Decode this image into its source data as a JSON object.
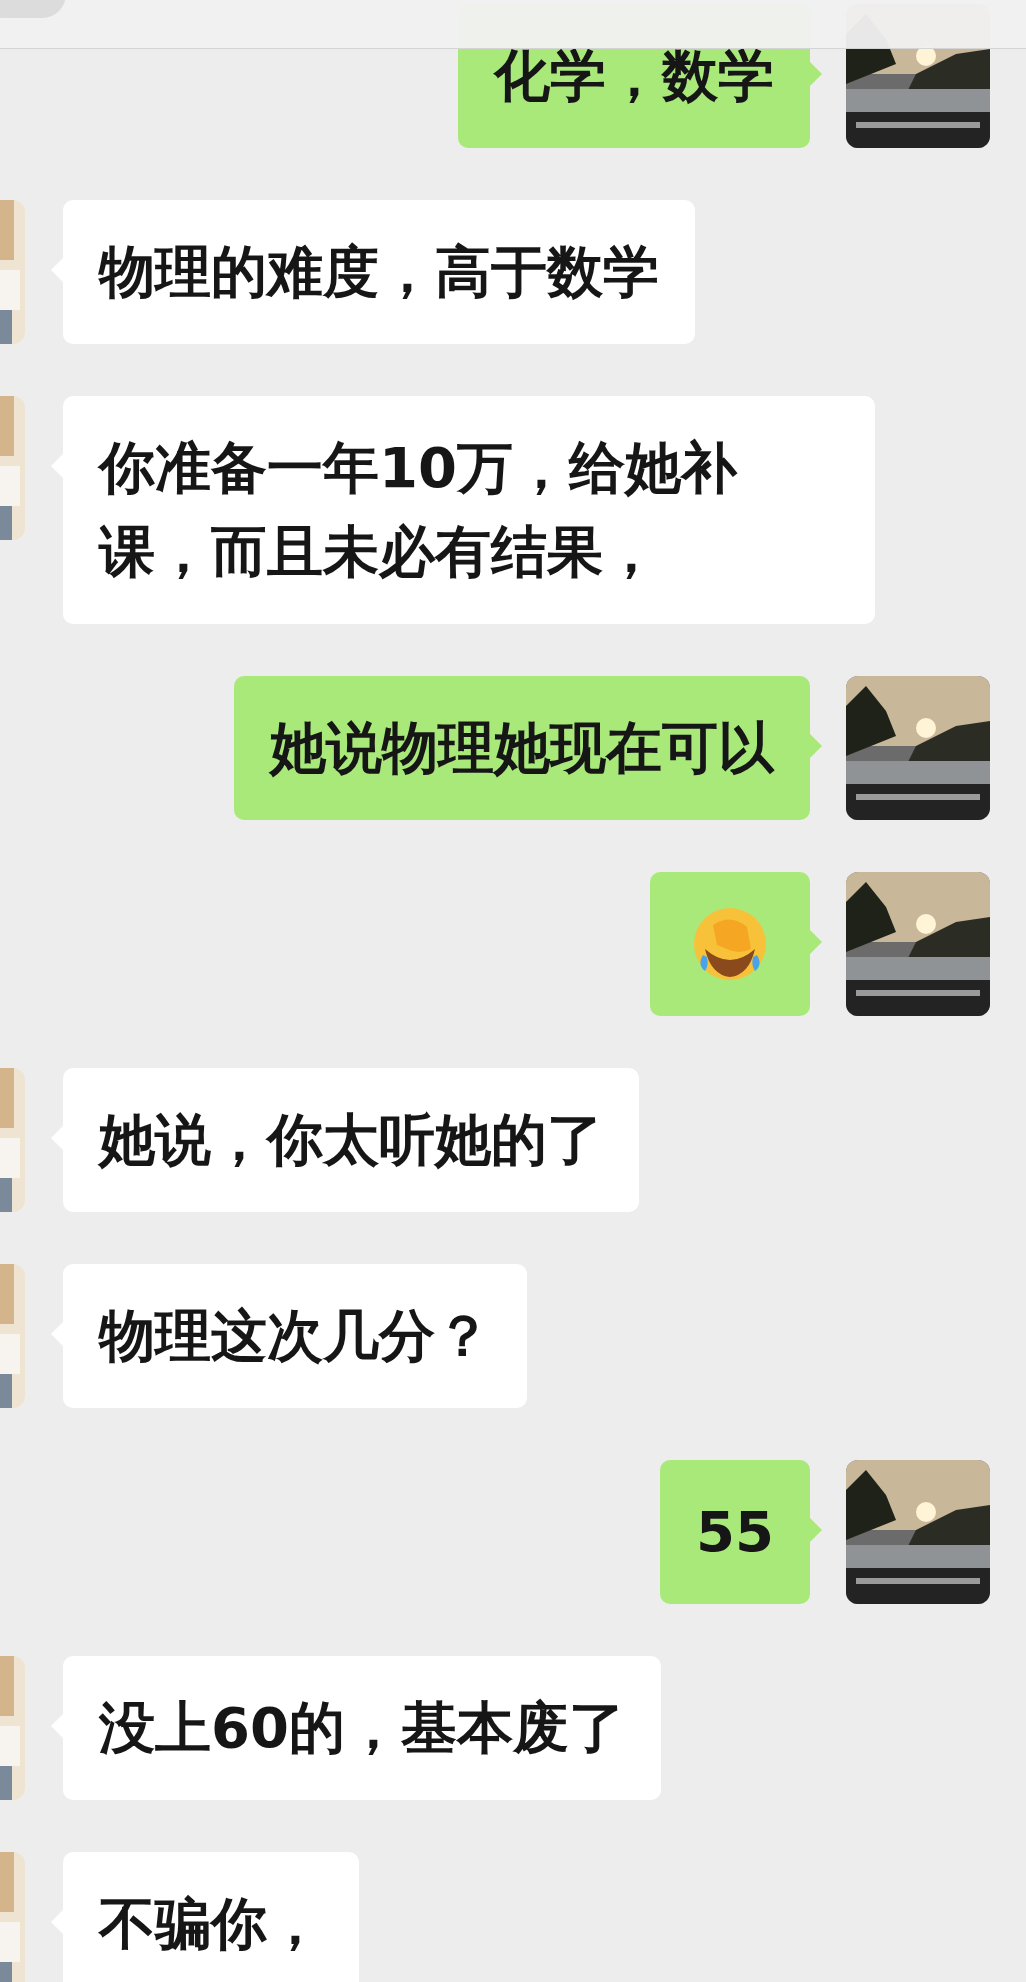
{
  "messages": [
    {
      "outgoing": true,
      "kind": "text",
      "text": "化学，数学"
    },
    {
      "outgoing": false,
      "kind": "text",
      "text": "物理的难度，高于数学"
    },
    {
      "outgoing": false,
      "kind": "text",
      "text": "你准备一年10万，给她补课，而且未必有结果，"
    },
    {
      "outgoing": true,
      "kind": "text",
      "text": "她说物理她现在可以"
    },
    {
      "outgoing": true,
      "kind": "emoji"
    },
    {
      "outgoing": false,
      "kind": "text",
      "text": "她说，你太听她的了"
    },
    {
      "outgoing": false,
      "kind": "text",
      "text": "物理这次几分？"
    },
    {
      "outgoing": true,
      "kind": "text",
      "text": "55"
    },
    {
      "outgoing": false,
      "kind": "text",
      "text": "没上60的，基本废了"
    },
    {
      "outgoing": false,
      "kind": "text",
      "text": "不骗你，"
    }
  ]
}
